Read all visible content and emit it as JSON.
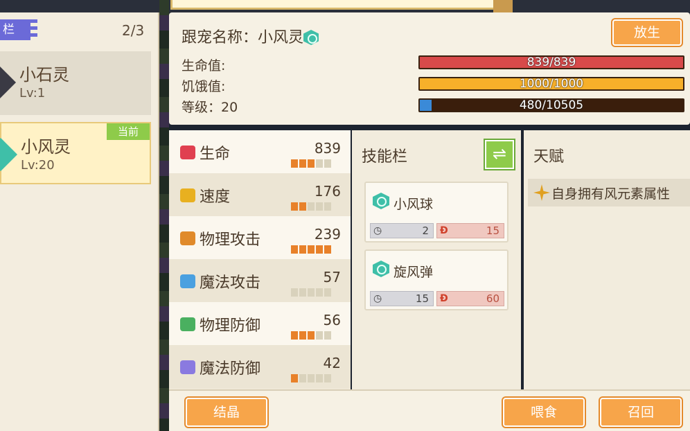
{
  "pet_list": {
    "tag_label": "栏",
    "count": "2/3",
    "items": [
      {
        "name": "小石灵",
        "level": "Lv:1",
        "current": false
      },
      {
        "name": "小风灵",
        "level": "Lv:20",
        "current": true,
        "badge": "当前"
      }
    ]
  },
  "pet_info": {
    "title": "跟宠名称：小风灵",
    "element_icon": "wind-element-icon",
    "release_label": "放生",
    "hp_label": "生命值:",
    "hunger_label": "饥饿值:",
    "level_label": "等级：20",
    "hp_text": "839/839",
    "hp_fraction": 1.0,
    "hunger_text": "1000/1000",
    "hunger_fraction": 1.0,
    "exp_text": "480/10505",
    "exp_fraction": 0.046,
    "colors": {
      "hp": "#d84a4a",
      "hunger": "#f7b02a",
      "exp": "#3a8ad8"
    }
  },
  "attributes": [
    {
      "name": "生命",
      "value": "839",
      "level": 3,
      "icon": "heart-icon",
      "color": "#e04050"
    },
    {
      "name": "速度",
      "value": "176",
      "level": 2,
      "icon": "boot-icon",
      "color": "#e8b020"
    },
    {
      "name": "物理攻击",
      "value": "239",
      "level": 5,
      "icon": "fist-icon",
      "color": "#e08a2a"
    },
    {
      "name": "魔法攻击",
      "value": "57",
      "level": 0,
      "icon": "magic-hand-icon",
      "color": "#4aa0e0"
    },
    {
      "name": "物理防御",
      "value": "56",
      "level": 3,
      "icon": "shield-icon",
      "color": "#4ab060"
    },
    {
      "name": "魔法防御",
      "value": "42",
      "level": 1,
      "icon": "flower-icon",
      "color": "#8a7ae0"
    }
  ],
  "skills": {
    "title": "技能栏",
    "swap_icon": "swap-icon",
    "items": [
      {
        "name": "小风球",
        "cooldown": "2",
        "cost": "15"
      },
      {
        "name": "旋风弹",
        "cooldown": "15",
        "cost": "60"
      }
    ]
  },
  "talent": {
    "title": "天赋",
    "items": [
      {
        "text": "自身拥有风元素属性"
      }
    ]
  },
  "actions": {
    "crystal_label": "结晶",
    "feed_label": "喂食",
    "recall_label": "召回"
  }
}
